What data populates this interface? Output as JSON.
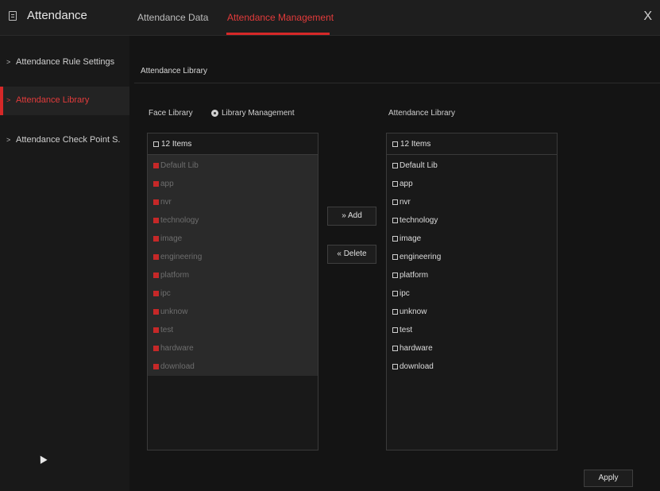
{
  "header": {
    "app_title": "Attendance",
    "tabs": [
      {
        "label": "Attendance Data",
        "active": false
      },
      {
        "label": "Attendance Management",
        "active": true
      }
    ],
    "close_label": "X"
  },
  "sidebar": {
    "items": [
      {
        "arrow": ">",
        "label": "Attendance Rule Settings",
        "active": false
      },
      {
        "arrow": ">",
        "label": "Attendance Library",
        "active": true
      },
      {
        "arrow": ">",
        "label": "Attendance Check Point S.",
        "active": false
      }
    ]
  },
  "main": {
    "section_title": "Attendance Library",
    "face_library_label": "Face Library",
    "library_management_label": "Library Management",
    "attendance_library_label": "Attendance Library",
    "left_panel": {
      "header": "12 Items",
      "items": [
        "Default Lib",
        "app",
        "nvr",
        "technology",
        "image",
        "engineering",
        "platform",
        "ipc",
        "unknow",
        "test",
        "hardware",
        "download"
      ]
    },
    "right_panel": {
      "header": "12 Items",
      "items": [
        "Default Lib",
        "app",
        "nvr",
        "technology",
        "image",
        "engineering",
        "platform",
        "ipc",
        "unknow",
        "test",
        "hardware",
        "download"
      ]
    },
    "add_button": "» Add",
    "delete_button": "« Delete",
    "apply_button": "Apply"
  },
  "colors": {
    "accent": "#d62828",
    "background": "#141414",
    "panel": "#191919"
  }
}
